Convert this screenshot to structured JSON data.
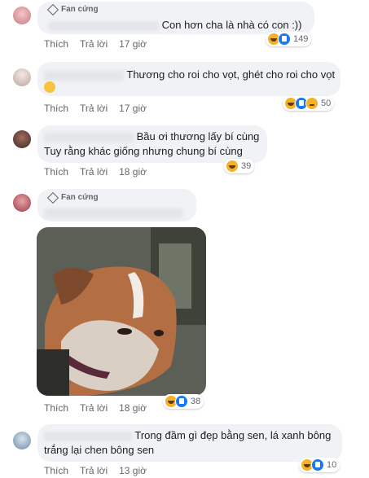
{
  "actions": {
    "like": "Thích",
    "reply": "Trả lời"
  },
  "comments": [
    {
      "badge": "Fan cứng",
      "text": "Con hơn cha là nhà có con :))",
      "time": "17 giờ",
      "reaction_count": "149",
      "reactions": [
        "haha",
        "like"
      ]
    },
    {
      "text": "Thương cho roi cho vọt, ghét cho roi cho vọt",
      "time": "17 giờ",
      "reaction_count": "50",
      "reactions": [
        "haha",
        "like",
        "sad"
      ]
    },
    {
      "line1": "Bầu ơi thương lấy bí cùng",
      "line2": "Tuy rằng khác giống nhưng chung bí cùng",
      "time": "18 giờ",
      "reaction_count": "39",
      "reactions": [
        "haha"
      ]
    },
    {
      "badge": "Fan cứng",
      "time": "18 giờ",
      "reaction_count": "38",
      "reactions": [
        "haha",
        "like"
      ]
    },
    {
      "line1": "Trong đầm gì đẹp bằng sen, lá xanh bông",
      "line2": "trắng lại chen bông sen",
      "time": "13 giờ",
      "reaction_count": "10",
      "reactions": [
        "haha",
        "like"
      ]
    }
  ],
  "colors": {
    "bubble": "#f0f2f5",
    "meta": "#65676b",
    "like_blue": "#1877f2",
    "haha_yellow": "#f7b125"
  }
}
